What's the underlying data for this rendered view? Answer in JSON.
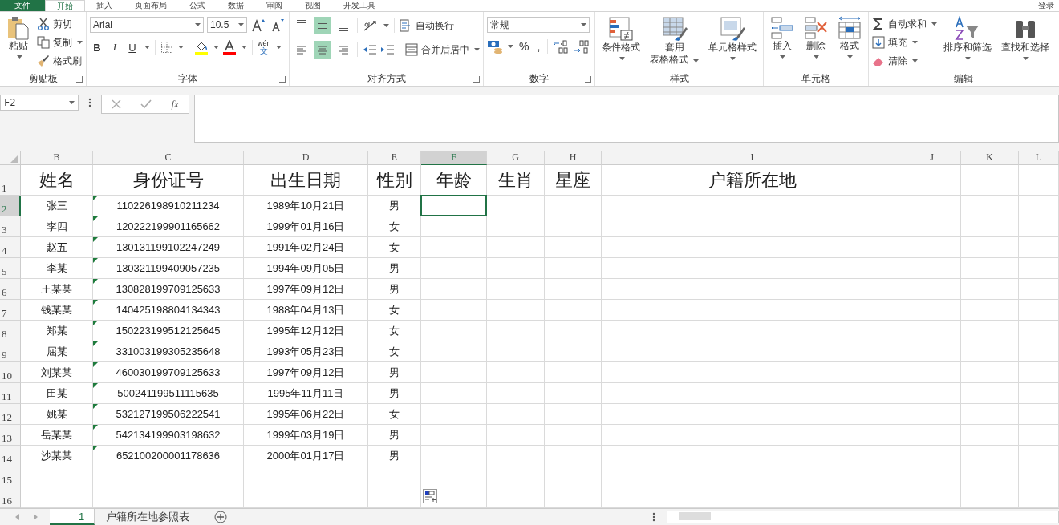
{
  "menu_tabs": [
    {
      "label": "文件",
      "selected": false
    },
    {
      "label": "开始",
      "selected": true
    },
    {
      "label": "插入",
      "selected": false
    },
    {
      "label": "页面布局",
      "selected": false
    },
    {
      "label": "公式",
      "selected": false
    },
    {
      "label": "数据",
      "selected": false
    },
    {
      "label": "审阅",
      "selected": false
    },
    {
      "label": "视图",
      "selected": false
    },
    {
      "label": "开发工具",
      "selected": false
    }
  ],
  "account": "登录",
  "ribbon": {
    "clipboard": {
      "label": "剪贴板",
      "paste": "粘贴",
      "cut": "剪切",
      "copy": "复制",
      "format_painter": "格式刷"
    },
    "font": {
      "label": "字体",
      "font_name": "Arial",
      "font_size": "10.5",
      "bold": "B",
      "italic": "I",
      "underline": "U",
      "phonetic_top": "wén",
      "phonetic_bottom": "文"
    },
    "alignment": {
      "label": "对齐方式",
      "wrap_text": "自动换行",
      "merge_center": "合并后居中",
      "vertical": [
        {
          "selected": false
        },
        {
          "selected": true
        },
        {
          "selected": false
        }
      ],
      "horizontal": [
        {
          "selected": false
        },
        {
          "selected": true
        },
        {
          "selected": false
        }
      ]
    },
    "number": {
      "label": "数字",
      "format": "常规",
      "percent": "%",
      "comma": ","
    },
    "styles": {
      "label": "样式",
      "conditional": "条件格式",
      "table_format_1": "套用",
      "table_format_2": "表格格式",
      "cell_styles": "单元格样式"
    },
    "cells": {
      "label": "单元格",
      "insert": "插入",
      "delete": "删除",
      "format": "格式"
    },
    "editing": {
      "label": "编辑",
      "autosum": "自动求和",
      "fill": "填充",
      "clear": "清除",
      "sort_filter": "排序和筛选",
      "find_select": "查找和选择"
    }
  },
  "name_box": "F2",
  "function_label": "fx",
  "columns": [
    {
      "label": "B",
      "selected": false
    },
    {
      "label": "C",
      "selected": false
    },
    {
      "label": "D",
      "selected": false
    },
    {
      "label": "E",
      "selected": false
    },
    {
      "label": "F",
      "selected": true
    },
    {
      "label": "G",
      "selected": false
    },
    {
      "label": "H",
      "selected": false
    },
    {
      "label": "I",
      "selected": false
    },
    {
      "label": "J",
      "selected": false
    },
    {
      "label": "K",
      "selected": false
    },
    {
      "label": "L",
      "selected": false
    }
  ],
  "header_row": {
    "row": "1",
    "cells": [
      "姓名",
      "身份证号",
      "出生日期",
      "性别",
      "年龄",
      "生肖",
      "星座",
      "户籍所在地"
    ]
  },
  "rows": [
    {
      "row": "2",
      "name": "张三",
      "id": "110226198910211234",
      "birth": "1989年10月21日",
      "gender": "男",
      "error_mark": true,
      "selected": true
    },
    {
      "row": "3",
      "name": "李四",
      "id": "120222199901165662",
      "birth": "1999年01月16日",
      "gender": "女",
      "error_mark": true,
      "selected": false
    },
    {
      "row": "4",
      "name": "赵五",
      "id": "130131199102247249",
      "birth": "1991年02月24日",
      "gender": "女",
      "error_mark": true,
      "selected": false
    },
    {
      "row": "5",
      "name": "李某",
      "id": "130321199409057235",
      "birth": "1994年09月05日",
      "gender": "男",
      "error_mark": true,
      "selected": false
    },
    {
      "row": "6",
      "name": "王某某",
      "id": "130828199709125633",
      "birth": "1997年09月12日",
      "gender": "男",
      "error_mark": true,
      "selected": false
    },
    {
      "row": "7",
      "name": "钱某某",
      "id": "140425198804134343",
      "birth": "1988年04月13日",
      "gender": "女",
      "error_mark": true,
      "selected": false
    },
    {
      "row": "8",
      "name": "郑某",
      "id": "150223199512125645",
      "birth": "1995年12月12日",
      "gender": "女",
      "error_mark": true,
      "selected": false
    },
    {
      "row": "9",
      "name": "屈某",
      "id": "331003199305235648",
      "birth": "1993年05月23日",
      "gender": "女",
      "error_mark": true,
      "selected": false
    },
    {
      "row": "10",
      "name": "刘某某",
      "id": "460030199709125633",
      "birth": "1997年09月12日",
      "gender": "男",
      "error_mark": true,
      "selected": false
    },
    {
      "row": "11",
      "name": "田某",
      "id": "500241199511115635",
      "birth": "1995年11月11日",
      "gender": "男",
      "error_mark": true,
      "selected": false
    },
    {
      "row": "12",
      "name": "姚某",
      "id": "532127199506222541",
      "birth": "1995年06月22日",
      "gender": "女",
      "error_mark": true,
      "selected": false
    },
    {
      "row": "13",
      "name": "岳某某",
      "id": "542134199903198632",
      "birth": "1999年03月19日",
      "gender": "男",
      "error_mark": true,
      "selected": false
    },
    {
      "row": "14",
      "name": "沙某某",
      "id": "652100200001178636",
      "birth": "2000年01月17日",
      "gender": "男",
      "error_mark": true,
      "selected": false
    }
  ],
  "empty_rows": [
    "15",
    "16"
  ],
  "sheet_tabs": [
    {
      "label": "1",
      "selected": true
    },
    {
      "label": "户籍所在地参照表",
      "selected": false
    }
  ]
}
